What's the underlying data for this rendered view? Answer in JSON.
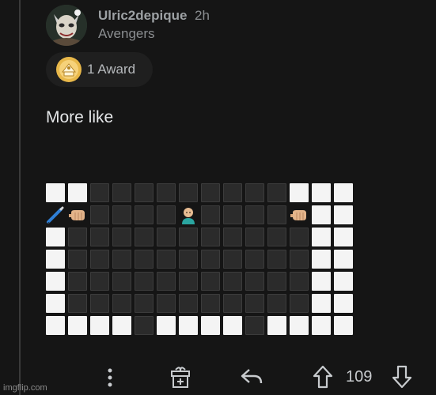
{
  "post": {
    "username": "Ulric2depique",
    "timestamp": "2h",
    "subreddit": "Avengers",
    "award_label": "1 Award",
    "comment_text": "More like"
  },
  "grid": {
    "rows": [
      "WWBBBBBBBBBWWW",
      "pfBBBBmBBBBfWW",
      "WBBBBBBBBBBBWW",
      "WBBBBBBBBBBBWW",
      "WBBBBBBBBBBBWW",
      "WBBBBBBBBBBBWW",
      "WWWWBWWWWBWWWW"
    ],
    "legend": {
      "W": "white-square",
      "B": "black-square",
      "p": "pen-emoji",
      "f": "fist-emoji",
      "m": "man-emoji"
    }
  },
  "actions": {
    "vote_count": "109",
    "icons": [
      "more-options-icon",
      "gift-icon",
      "reply-icon",
      "upvote-icon",
      "downvote-icon"
    ]
  },
  "watermark": "imgflip.com",
  "colors": {
    "background": "#151515",
    "white_square": "#f4f4f4",
    "black_square": "#2b2b2b",
    "award_gold": "#e8b84a"
  }
}
